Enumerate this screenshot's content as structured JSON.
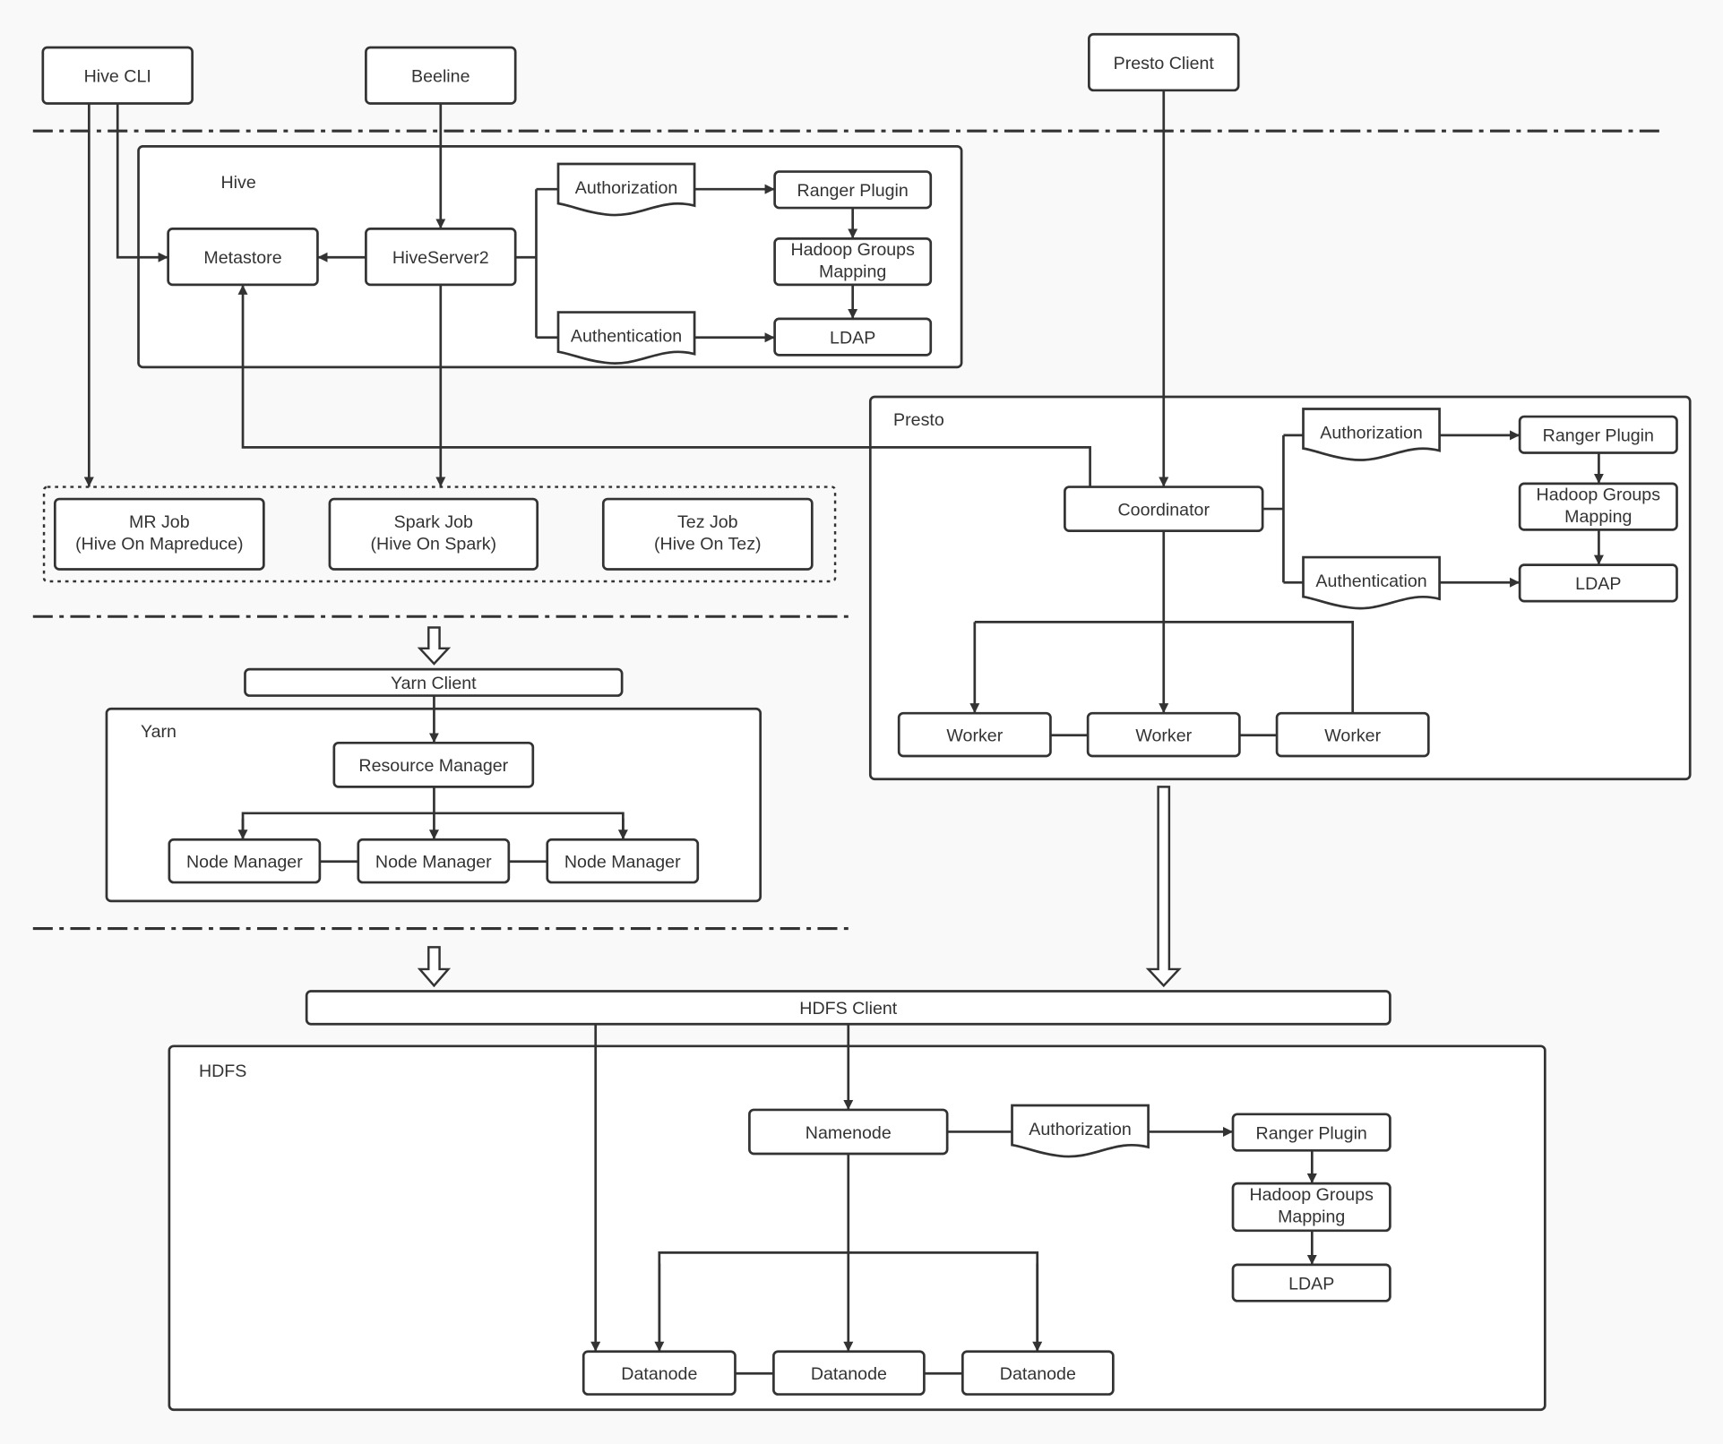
{
  "clients": {
    "hive_cli": "Hive CLI",
    "beeline": "Beeline",
    "presto_client": "Presto Client"
  },
  "hive": {
    "label": "Hive",
    "metastore": "Metastore",
    "hiveserver2": "HiveServer2",
    "authorization": "Authorization",
    "authentication": "Authentication",
    "ranger": "Ranger Plugin",
    "hadoop_groups_1": "Hadoop Groups",
    "hadoop_groups_2": "Mapping",
    "ldap": "LDAP"
  },
  "jobs": [
    {
      "line1": "MR Job",
      "line2": "(Hive On Mapreduce)"
    },
    {
      "line1": "Spark Job",
      "line2": "(Hive On Spark)"
    },
    {
      "line1": "Tez Job",
      "line2": "(Hive On Tez)"
    }
  ],
  "yarn": {
    "client": "Yarn Client",
    "label": "Yarn",
    "resource_manager": "Resource Manager",
    "node_manager": "Node Manager"
  },
  "presto": {
    "label": "Presto",
    "coordinator": "Coordinator",
    "worker": "Worker",
    "authorization": "Authorization",
    "authentication": "Authentication",
    "ranger": "Ranger Plugin",
    "hadoop_groups_1": "Hadoop Groups",
    "hadoop_groups_2": "Mapping",
    "ldap": "LDAP"
  },
  "hdfs": {
    "client": "HDFS Client",
    "label": "HDFS",
    "namenode": "Namenode",
    "datanode": "Datanode",
    "authorization": "Authorization",
    "ranger": "Ranger Plugin",
    "hadoop_groups_1": "Hadoop Groups",
    "hadoop_groups_2": "Mapping",
    "ldap": "LDAP"
  },
  "colors": {
    "stroke": "#333333",
    "background": "#f9f9f9",
    "box": "#ffffff"
  }
}
